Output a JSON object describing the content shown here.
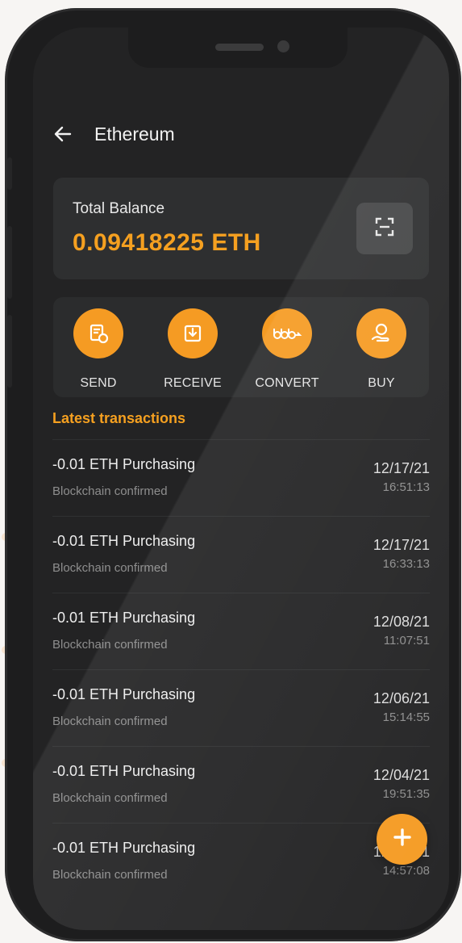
{
  "header": {
    "title": "Ethereum"
  },
  "balance": {
    "label": "Total Balance",
    "value": "0.09418225 ETH"
  },
  "actions": [
    {
      "label": "SEND",
      "icon": "send-icon"
    },
    {
      "label": "RECEIVE",
      "icon": "receive-icon"
    },
    {
      "label": "CONVERT",
      "icon": "convert-icon"
    },
    {
      "label": "BUY",
      "icon": "buy-icon"
    }
  ],
  "transactions_title": "Latest transactions",
  "transactions": [
    {
      "title": "-0.01 ETH Purchasing",
      "status": "Blockchain confirmed",
      "date": "12/17/21",
      "time": "16:51:13"
    },
    {
      "title": "-0.01 ETH Purchasing",
      "status": "Blockchain confirmed",
      "date": "12/17/21",
      "time": "16:33:13"
    },
    {
      "title": "-0.01 ETH Purchasing",
      "status": "Blockchain confirmed",
      "date": "12/08/21",
      "time": "11:07:51"
    },
    {
      "title": "-0.01 ETH Purchasing",
      "status": "Blockchain confirmed",
      "date": "12/06/21",
      "time": "15:14:55"
    },
    {
      "title": "-0.01 ETH Purchasing",
      "status": "Blockchain confirmed",
      "date": "12/04/21",
      "time": "19:51:35"
    },
    {
      "title": "-0.01 ETH Purchasing",
      "status": "Blockchain confirmed",
      "date": "12/02/21",
      "time": "14:57:08"
    }
  ],
  "colors": {
    "accent": "#f59b23",
    "background": "#232324",
    "card": "#2e2f30"
  },
  "icons": {
    "back": "arrow-left-icon",
    "scan": "scan-icon",
    "fab": "plus-icon"
  }
}
